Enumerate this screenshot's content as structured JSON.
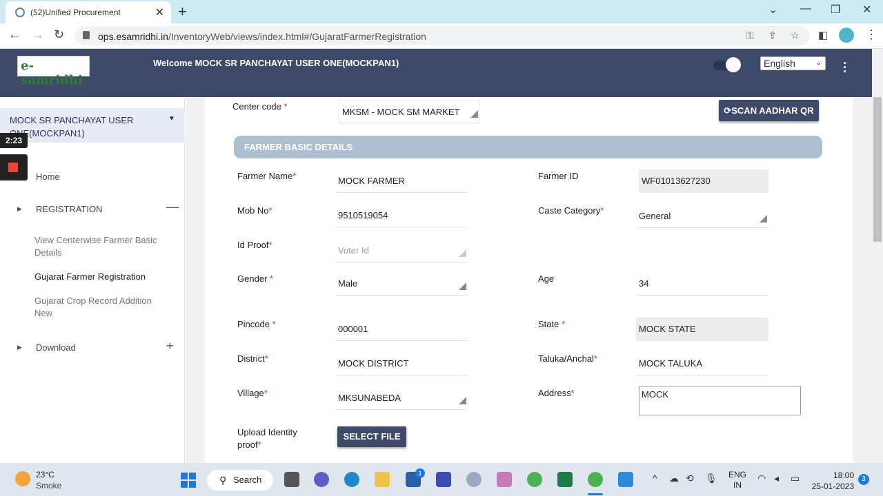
{
  "browser": {
    "tab_title": "(52)Unified Procurement",
    "url_domain": "ops.esamridhi.in",
    "url_path": "/InventoryWeb/views/index.html#/GujaratFarmerRegistration"
  },
  "header": {
    "logo_text": "e-samridhi",
    "welcome": "Welcome MOCK SR PANCHAYAT USER ONE(MOCKPAN1)",
    "language": "English"
  },
  "sidebar": {
    "user": "MOCK SR PANCHAYAT USER ONE(MOCKPAN1)",
    "timer": "2:23",
    "home": "Home",
    "registration": "REGISTRATION",
    "sub_items": [
      "View Centerwise Farmer Basic Details",
      "Gujarat Farmer Registration",
      "Gujarat Crop Record Addition New"
    ],
    "download": "Download"
  },
  "form": {
    "center_code_label": "Center code",
    "center_code_value": "MKSM - MOCK SM MARKET",
    "scan_button": "SCAN AADHAR QR",
    "section_title": "FARMER BASIC DETAILS",
    "farmer_name_label": "Farmer Name",
    "farmer_name": "MOCK FARMER",
    "farmer_id_label": "Farmer ID",
    "farmer_id": "WF01013627230",
    "mob_label": "Mob No",
    "mob": "9510519054",
    "caste_label": "Caste Category",
    "caste": "General",
    "id_proof_label": "Id Proof",
    "id_proof_placeholder": "Voter Id",
    "gender_label": "Gender",
    "gender": "Male",
    "age_label": "Age",
    "age": "34",
    "pincode_label": "Pincode",
    "pincode": "000001",
    "state_label": "State",
    "state": "MOCK STATE",
    "district_label": "District",
    "district": "MOCK DISTRICT",
    "taluka_label": "Taluka/Anchal",
    "taluka": "MOCK TALUKA",
    "village_label": "Village",
    "village": "MKSUNABEDA",
    "address_label": "Address",
    "address": "MOCK",
    "upload_label": "Upload Identity proof",
    "select_file": "SELECT FILE",
    "required_mark": "*"
  },
  "taskbar": {
    "temperature": "23°C",
    "weather": "Smoke",
    "search": "Search",
    "lang1": "ENG",
    "lang2": "IN",
    "time": "18:00",
    "date": "25-01-2023",
    "notifications": "3",
    "badge": "1"
  }
}
